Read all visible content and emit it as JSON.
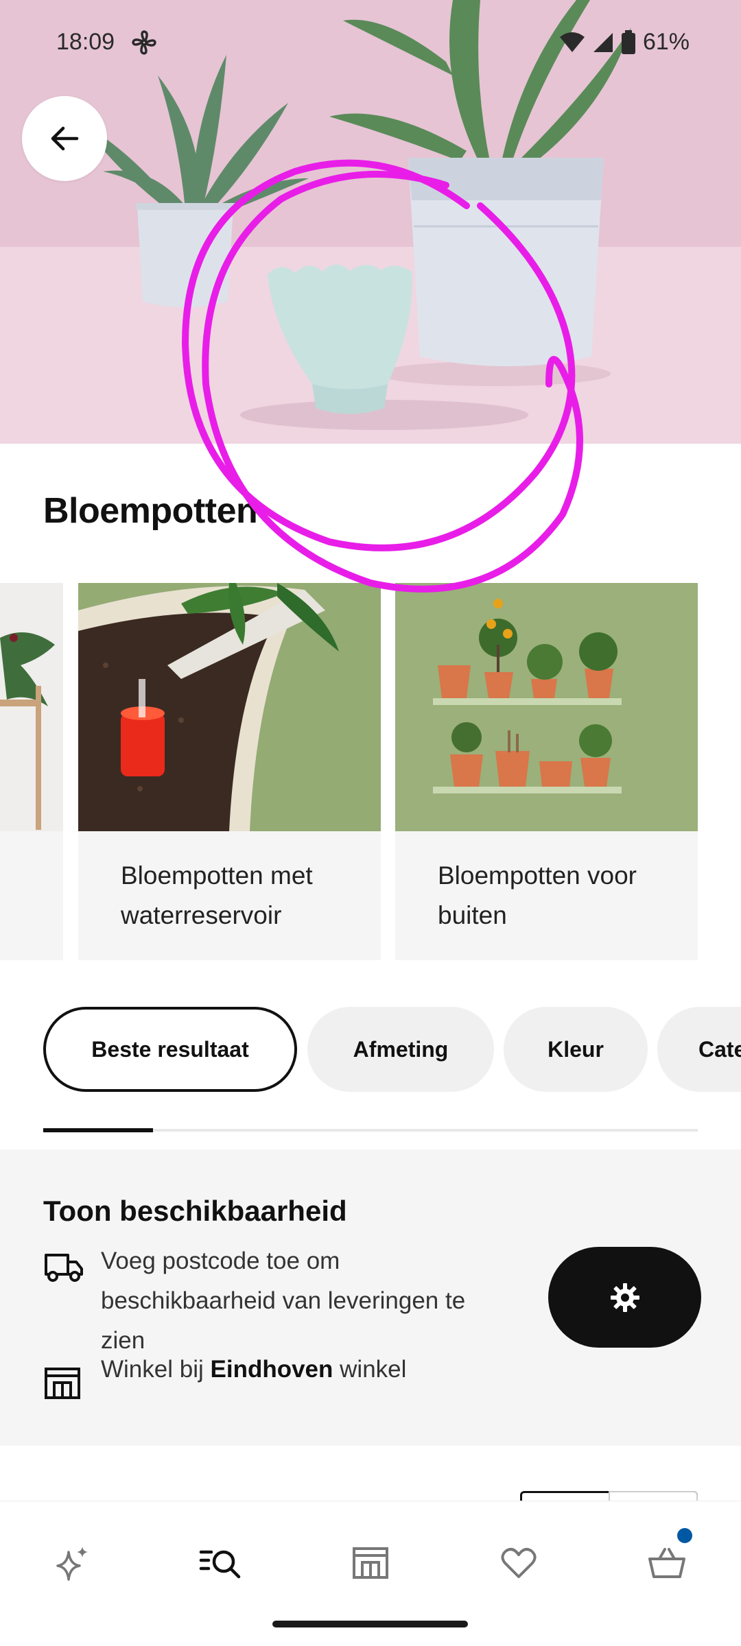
{
  "status_bar": {
    "time": "18:09",
    "battery": "61%"
  },
  "header": {
    "back_icon": "arrow-left-icon",
    "title": "Bloempotten"
  },
  "categories": [
    {
      "label": ""
    },
    {
      "label": "Bloempotten met waterreservoir"
    },
    {
      "label": "Bloempotten voor buiten"
    }
  ],
  "filters": [
    {
      "label": "Beste resultaat",
      "active": true
    },
    {
      "label": "Afmeting",
      "active": false
    },
    {
      "label": "Kleur",
      "active": false
    },
    {
      "label": "Cate",
      "active": false
    }
  ],
  "availability": {
    "title": "Toon beschikbaarheid",
    "delivery_text": "Voeg postcode toe om beschikbaarheid van leveringen te zien",
    "store_prefix": "Winkel bij",
    "store_name": "Eindhoven",
    "store_suffix": "winkel",
    "delivery_icon": "truck-icon",
    "store_icon": "store-icon",
    "settings_icon": "gear-icon"
  },
  "bottom_nav": [
    {
      "name": "sparkle-icon"
    },
    {
      "name": "search-list-icon",
      "active": true
    },
    {
      "name": "store-icon"
    },
    {
      "name": "heart-icon"
    },
    {
      "name": "basket-icon",
      "badge": true
    }
  ],
  "colors": {
    "annotation": "#e81ee8",
    "accent_blue": "#0058a3",
    "chip_bg": "#f0f0f0",
    "panel_bg": "#f5f5f5"
  }
}
